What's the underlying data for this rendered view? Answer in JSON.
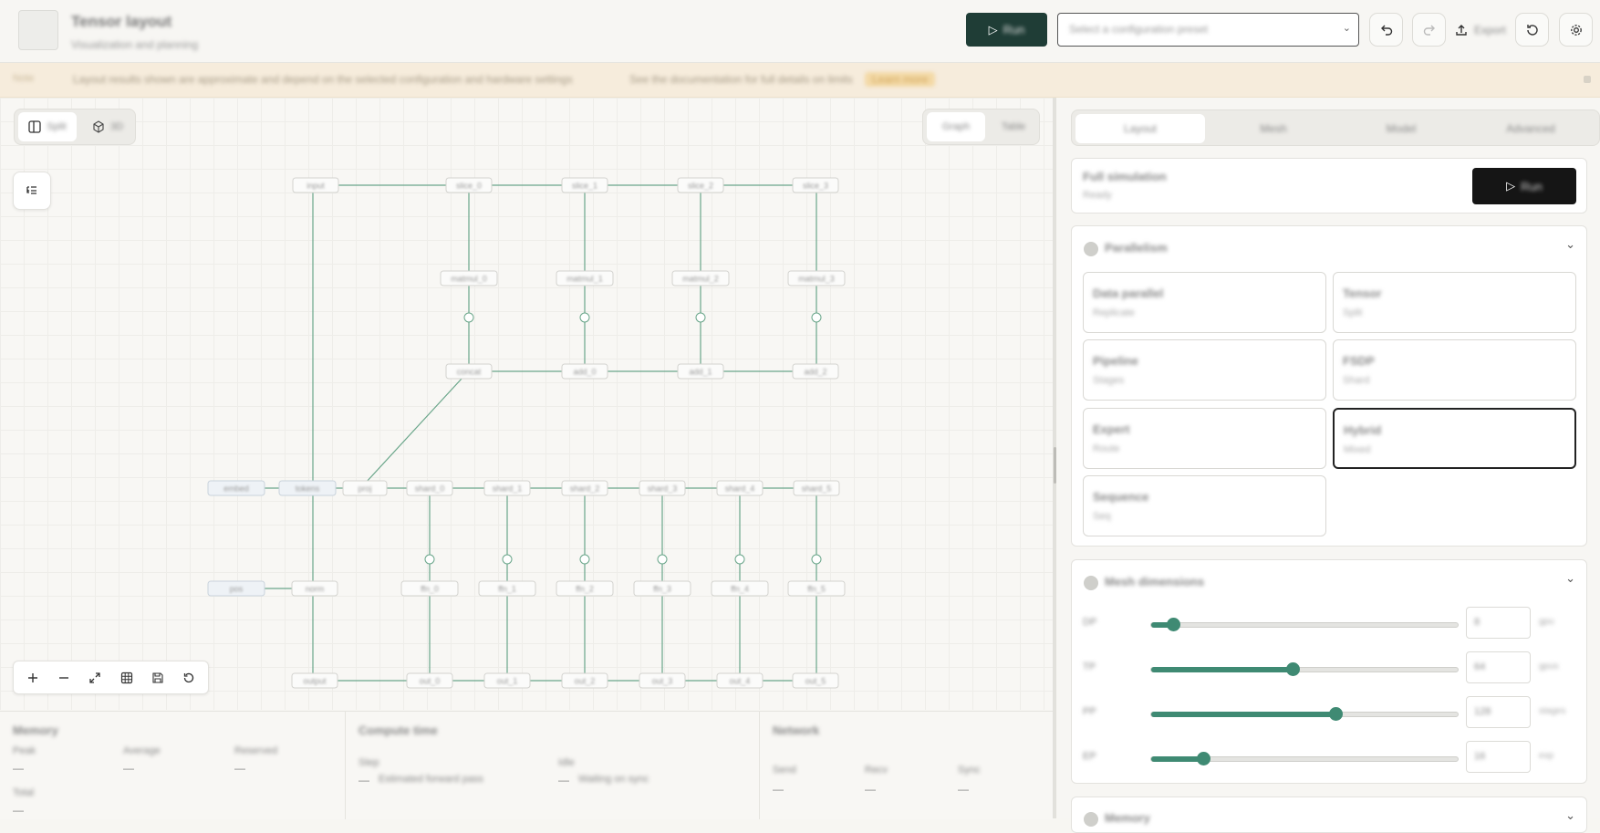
{
  "header": {
    "app_title": "Tensor layout",
    "app_subtitle": "Visualization and planning",
    "run_label": "Run",
    "preset_value": "Select a configuration preset",
    "export_label": "Export"
  },
  "banner": {
    "tag": "Note",
    "message": "Layout results shown are approximate and depend on the selected configuration and hardware settings",
    "detail": "See the documentation for full details on limits",
    "link": "Learn more"
  },
  "canvas": {
    "view_toggle": [
      {
        "label": "Split",
        "icon": "panel-icon"
      },
      {
        "label": "3D",
        "icon": "cube-icon"
      }
    ],
    "mode_toggle": [
      "Graph",
      "Table"
    ],
    "node_labels": {
      "top_row": [
        "input",
        "slice_0",
        "slice_1",
        "slice_2",
        "slice_3"
      ],
      "mid_row": [
        "matmul_0",
        "matmul_1",
        "matmul_2",
        "matmul_3"
      ],
      "reduce_row": [
        "concat",
        "add_0",
        "add_1",
        "add_2"
      ],
      "bus_row": [
        "embed",
        "tokens",
        "proj",
        "shard_0",
        "shard_1",
        "shard_2",
        "shard_3",
        "shard_4",
        "shard_5"
      ],
      "low_row": [
        "pos",
        "norm",
        "ffn_0",
        "ffn_1",
        "ffn_2",
        "ffn_3",
        "ffn_4",
        "ffn_5"
      ],
      "bottom_row": [
        "output",
        "out_0",
        "out_1",
        "out_2",
        "out_3",
        "out_4",
        "out_5"
      ]
    }
  },
  "stats": {
    "memory": {
      "title": "Memory",
      "items": [
        {
          "label": "Peak",
          "value": "—"
        },
        {
          "label": "Average",
          "value": "—"
        },
        {
          "label": "Reserved",
          "value": "—"
        },
        {
          "label": "Total",
          "value": "—"
        }
      ]
    },
    "compute": {
      "title": "Compute time",
      "items": [
        {
          "label": "Step",
          "value": "—",
          "detail": "Estimated forward pass"
        },
        {
          "label": "Idle",
          "value": "—",
          "detail": "Waiting on sync"
        }
      ]
    },
    "network": {
      "title": "Network",
      "items": [
        {
          "label": "Send",
          "value": "—"
        },
        {
          "label": "Recv",
          "value": "—"
        },
        {
          "label": "Sync",
          "value": "—"
        }
      ]
    }
  },
  "panel": {
    "tabs": [
      "Layout",
      "Mesh",
      "Model",
      "Advanced"
    ],
    "run_card": {
      "title": "Full simulation",
      "subtitle": "Ready",
      "button": "Run"
    },
    "strategy": {
      "title": "Parallelism",
      "options": [
        {
          "title": "Data parallel",
          "sub": "Replicate"
        },
        {
          "title": "Tensor",
          "sub": "Split"
        },
        {
          "title": "Pipeline",
          "sub": "Stages"
        },
        {
          "title": "FSDP",
          "sub": "Shard"
        },
        {
          "title": "Expert",
          "sub": "Route"
        },
        {
          "title": "Hybrid",
          "sub": "Mixed"
        },
        {
          "title": "Sequence",
          "sub": "Seq"
        }
      ],
      "selected_index": 5
    },
    "dimensions": {
      "title": "Mesh dimensions",
      "sliders": [
        {
          "label": "DP",
          "value": 8,
          "fraction": 0.07,
          "unit": "gpu"
        },
        {
          "label": "TP",
          "value": 64,
          "fraction": 0.46,
          "unit": "gpus"
        },
        {
          "label": "PP",
          "value": 128,
          "fraction": 0.6,
          "unit": "stages"
        },
        {
          "label": "EP",
          "value": 16,
          "fraction": 0.17,
          "unit": "exp"
        }
      ]
    },
    "collapsed_section": "Memory"
  }
}
